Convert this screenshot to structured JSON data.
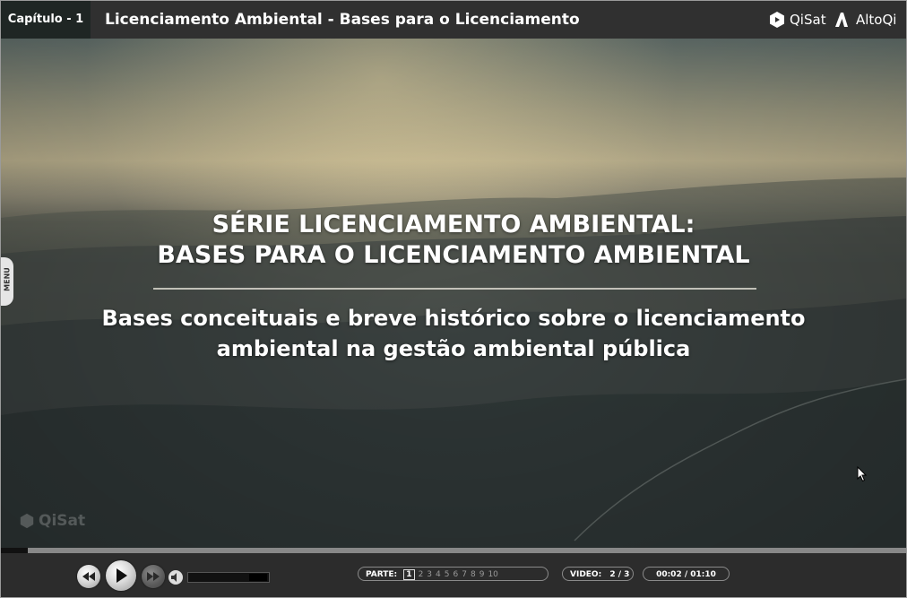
{
  "header": {
    "chapter": "Capítulo - 1",
    "title": "Licenciamento Ambiental - Bases para o Licenciamento",
    "brands": [
      "QiSat",
      "AltoQi"
    ]
  },
  "slide": {
    "title_line1": "SÉRIE LICENCIAMENTO AMBIENTAL:",
    "title_line2": "BASES PARA O LICENCIAMENTO AMBIENTAL",
    "subtitle_line1": "Bases conceituais e breve histórico sobre o licenciamento",
    "subtitle_line2": "ambiental na gestão ambiental pública",
    "watermark": "QiSat"
  },
  "menu_tab": {
    "label": "MENU"
  },
  "player": {
    "progress_fraction": 0.03,
    "volume_fraction": 0.25,
    "parts_label": "PARTE:",
    "parts": [
      "1",
      "2",
      "3",
      "4",
      "5",
      "6",
      "7",
      "8",
      "9",
      "10"
    ],
    "active_part": "1",
    "video_label": "VIDEO:",
    "video_value": "2 / 3",
    "time": "00:02 / 01:10"
  },
  "icons": [
    "rewind-icon",
    "play-icon",
    "fast-forward-icon",
    "volume-icon",
    "qisat-logo-icon",
    "altoqi-logo-icon",
    "mouse-cursor-icon"
  ]
}
